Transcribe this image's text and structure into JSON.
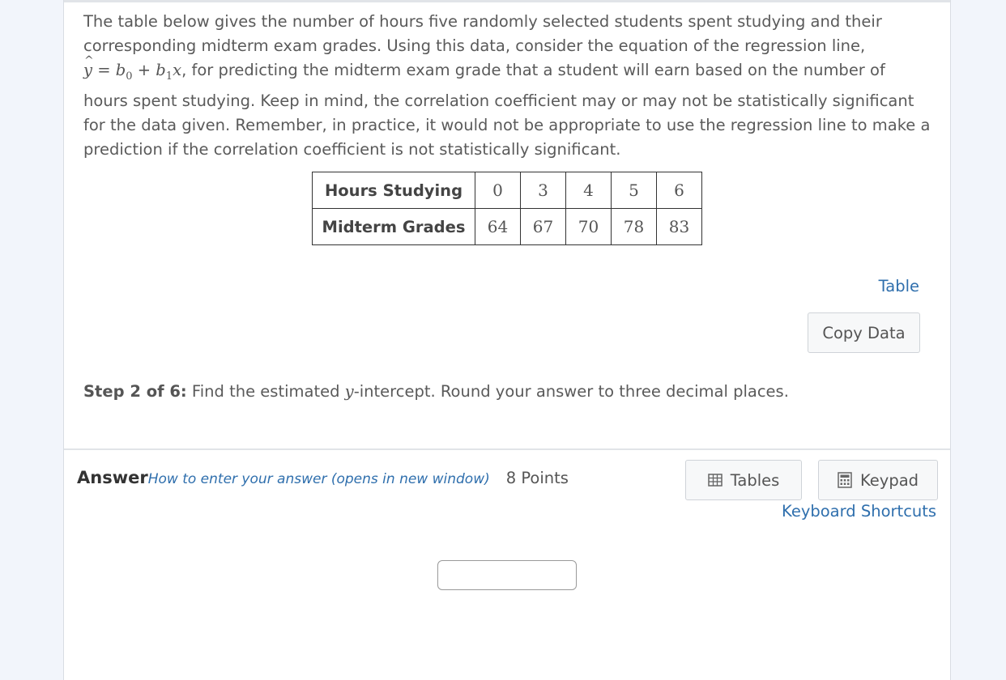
{
  "question": {
    "intro": "The table below gives the number of hours five randomly selected students spent studying and their corresponding midterm exam grades. Using this data, consider the equation of the regression line,",
    "equation": {
      "lhs": "y",
      "hat": "^",
      "eq": "=",
      "b0": "b",
      "b0_sub": "0",
      "plus": "+",
      "b1": "b",
      "b1_sub": "1",
      "x": "x"
    },
    "continuation": ", for predicting the midterm exam grade that a student will earn based on the number of hours spent studying. Keep in mind, the correlation coefficient may or may not be statistically significant for the data given. Remember, in practice, it would not be appropriate to use the regression line to make a prediction if the correlation coefficient is not statistically significant."
  },
  "table": {
    "rows": [
      {
        "header": "Hours Studying",
        "values": [
          "0",
          "3",
          "4",
          "5",
          "6"
        ]
      },
      {
        "header": "Midterm Grades",
        "values": [
          "64",
          "67",
          "70",
          "78",
          "83"
        ]
      }
    ]
  },
  "table_link": "Table",
  "copy_data_label": "Copy Data",
  "step": {
    "prefix": "Step 2 of 6:",
    "text_before": " Find the estimated ",
    "var": "y",
    "text_after": "-intercept. Round your answer to three decimal places."
  },
  "answer": {
    "label": "Answer",
    "help_link": "How to enter your answer (opens in new window)",
    "points": "8 Points",
    "tables_label": "Tables",
    "keypad_label": "Keypad",
    "shortcuts_label": "Keyboard Shortcuts",
    "input_value": ""
  },
  "icons": {
    "tables": "table-grid-icon",
    "keypad": "calculator-keypad-icon"
  }
}
